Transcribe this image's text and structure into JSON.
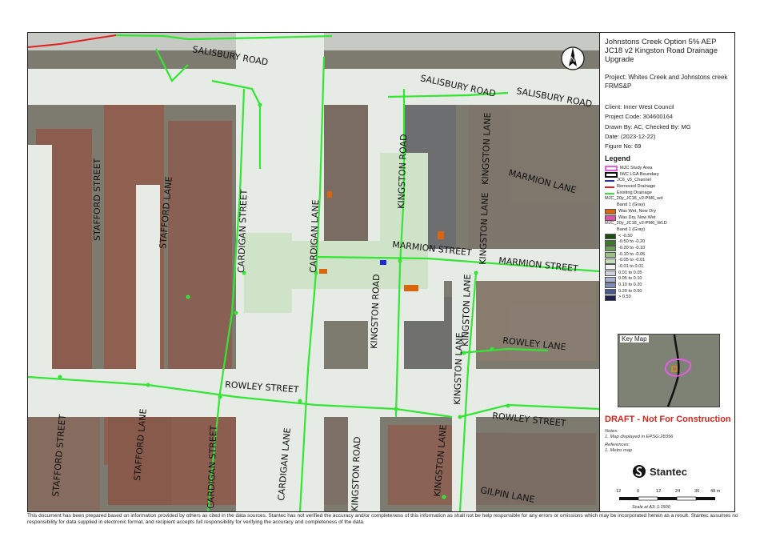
{
  "title": {
    "line1": "Johnstons Creek Option 5% AEP",
    "line2": "JC18 v2 Kingston Road Drainage",
    "line3": "Upgrade"
  },
  "project": {
    "label": "Project:",
    "value": "Whites Creek and Johnstons creek FRMS&P"
  },
  "info": {
    "client": "Client:  Inner West Council",
    "project_code": "Project Code:  304600164",
    "drawn_by": "Drawn By:  AC, Checked By: MG",
    "date": "Date:  (2023-12-22)",
    "figure_no": "Figure No:  69"
  },
  "legend": {
    "title": "Legend",
    "items": [
      {
        "label": "MJC Study Area",
        "color": "#e65ce6",
        "kind": "outline"
      },
      {
        "label": "IWC LGA Boundary",
        "color": "#111111",
        "kind": "outline"
      },
      {
        "label": "JC6_v5_Channel",
        "color": "#1c2bd9",
        "kind": "line"
      },
      {
        "label": "Removed Drainage",
        "color": "#e01f1f",
        "kind": "line"
      },
      {
        "label": "Existing Drainage",
        "color": "#33e633",
        "kind": "line"
      },
      {
        "label": "MJC_20y_JC18_v2-PM6_wd",
        "color": "",
        "kind": "header"
      },
      {
        "label": "Band 1 (Gray)",
        "color": "",
        "kind": "subheader"
      },
      {
        "label": "Was Wet, Now Dry",
        "color": "#d9660f",
        "kind": "fill"
      },
      {
        "label": "Was Dry, Now Wet",
        "color": "#e04fa6",
        "kind": "fill"
      },
      {
        "label": "MJC_20y_JC18_v2-PM6_WLD",
        "color": "",
        "kind": "header"
      },
      {
        "label": "Band 1 (Gray)",
        "color": "",
        "kind": "subheader"
      },
      {
        "label": "< -0.50",
        "color": "#1f4d12",
        "kind": "fill"
      },
      {
        "label": "-0.50 to -0.20",
        "color": "#3c7a28",
        "kind": "fill"
      },
      {
        "label": "-0.20 to -0.10",
        "color": "#6a9e55",
        "kind": "fill"
      },
      {
        "label": "-0.10 to -0.05",
        "color": "#98c085",
        "kind": "fill"
      },
      {
        "label": "-0.05 to -0.01",
        "color": "#c4dcb8",
        "kind": "fill"
      },
      {
        "label": "-0.01 to 0.01",
        "color": "#f2f2f2",
        "kind": "fill"
      },
      {
        "label": "0.01 to 0.05",
        "color": "#ccd1e0",
        "kind": "fill"
      },
      {
        "label": "0.05 to 0.10",
        "color": "#a8b1cf",
        "kind": "fill"
      },
      {
        "label": "0.10 to 0.20",
        "color": "#7f8cb8",
        "kind": "fill"
      },
      {
        "label": "0.20 to 0.50",
        "color": "#4c5a94",
        "kind": "fill"
      },
      {
        "label": "> 0.50",
        "color": "#1c2152",
        "kind": "fill"
      }
    ]
  },
  "keymap": {
    "label": "Key Map"
  },
  "draft": "DRAFT - Not For Construction",
  "notes": {
    "title": "Notes:",
    "note1": "1. Map displayed in EPSG:28356",
    "ref_title": "References:",
    "ref1": "1. Metro map"
  },
  "logo": {
    "text": "Stantec"
  },
  "scale": {
    "ticks": [
      "12",
      "0",
      "12",
      "24",
      "36",
      "48 m"
    ],
    "note": "Scale at A3: 1:1500"
  },
  "north_label": "N",
  "roads": {
    "salisbury_w": "SALISBURY ROAD",
    "salisbury_e1": "SALISBURY ROAD",
    "salisbury_e2": "SALISBURY ROAD",
    "stafford_n": "STAFFORD STREET",
    "stafford_lane_n": "STAFFORD LANE",
    "cardigan_st_n": "CARDIGAN STREET",
    "cardigan_lane_n": "CARDIGAN LANE",
    "kingston_rd_n": "KINGSTON ROAD",
    "kingston_lane_n": "KINGSTON LANE",
    "kingston_lane_n2": "KINGSTON LANE",
    "marmion_lane": "MARMION LANE",
    "marmion_st_w": "MARMION STREET",
    "marmion_st_e": "MARMION STREET",
    "kingston_rd_mid": "KINGSTON ROAD",
    "kingston_lane_mid": "KINGSTON LANE",
    "kingston_lane_mid2": "KINGSTON LANE",
    "rowley_lane": "ROWLEY LANE",
    "rowley_st_w": "ROWLEY STREET",
    "rowley_st_e": "ROWLEY STREET",
    "stafford_s": "STAFFORD STREET",
    "stafford_lane_s": "STAFFORD LANE",
    "cardigan_st_s": "CARDIGAN STREET",
    "cardigan_lane_s": "CARDIGAN LANE",
    "kingston_rd_s": "KINGSTON ROAD",
    "kingston_lane_s": "KINGSTON LANE",
    "gilpin_lane": "GILPIN LANE"
  },
  "disclaimer": "This document has been prepared based on information provided by others as cited in the data sources. Stantec has not verified the accuracy and/or completeness of this information as shall not be help responsible for any errors or omissions which may be incorporated herein as a result. Stantec assumes no responsibility for data supplied in electronic format, and recipient accepts full responsibility for verifying the accuracy and completeness of the data."
}
